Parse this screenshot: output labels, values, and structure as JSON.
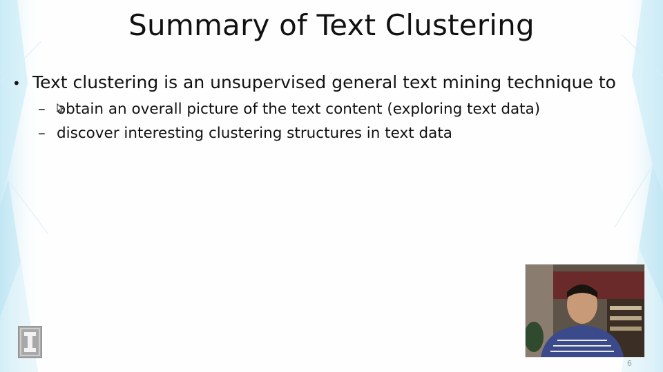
{
  "slide": {
    "title": "Summary of Text Clustering",
    "bullet": {
      "symbol": "•",
      "text": "Text clustering is an unsupervised general text mining technique to"
    },
    "sub_items": [
      {
        "symbol": "–",
        "text": "obtain an overall picture of the text content (exploring text data)"
      },
      {
        "symbol": "–",
        "text": "discover interesting clustering structures in text data"
      }
    ],
    "page_number": "6"
  },
  "colors": {
    "background": "#fefefe",
    "accent_cyan": "#b8e4f2",
    "text": "#111111",
    "logo_gray": "#a8a8a8"
  },
  "icons": {
    "logo": "university-logo-icon",
    "cursor": "mouse-cursor-icon",
    "presenter": "presenter-video"
  }
}
